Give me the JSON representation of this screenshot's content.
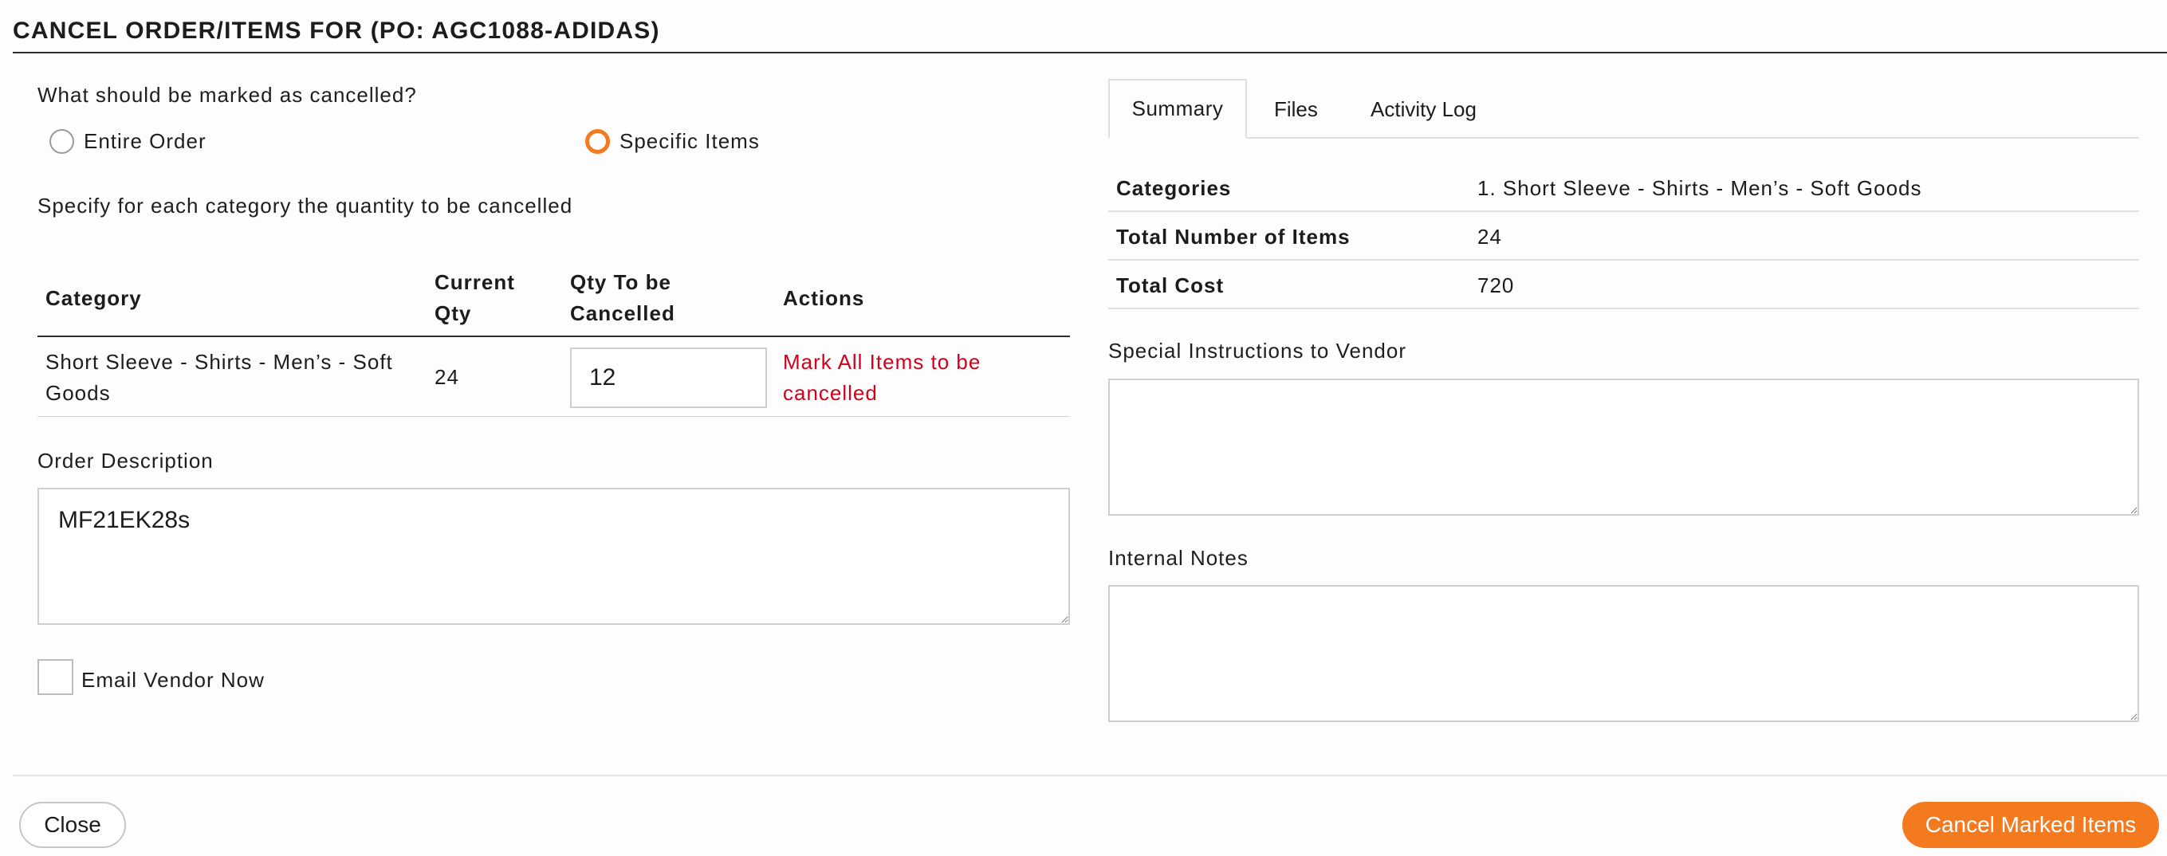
{
  "dialog": {
    "title": "CANCEL ORDER/ITEMS FOR (PO: AGC1088-ADIDAS)"
  },
  "left": {
    "question": "What should be marked as cancelled?",
    "options": [
      {
        "label": "Entire Order",
        "selected": false
      },
      {
        "label": "Specific Items",
        "selected": true
      }
    ],
    "instruction": "Specify for each category the quantity to be cancelled",
    "table": {
      "headers": {
        "category": "Category",
        "current_qty_line1": "Current",
        "current_qty_line2": "Qty",
        "qty_cancel_line1": "Qty To be",
        "qty_cancel_line2": "Cancelled",
        "actions": "Actions"
      },
      "rows": [
        {
          "category_line1": "Short Sleeve - Shirts - Men’s - Soft",
          "category_line2": "Goods",
          "current_qty": "24",
          "qty_to_cancel": "12",
          "action_line1": "Mark All Items to be",
          "action_line2": "cancelled"
        }
      ]
    },
    "order_description_label": "Order Description",
    "order_description_value": "MF21EK28s",
    "email_vendor_label": "Email Vendor Now",
    "email_vendor_checked": false
  },
  "right": {
    "tabs": [
      "Summary",
      "Files",
      "Activity Log"
    ],
    "active_tab": "Summary",
    "summary": [
      {
        "label": "Categories",
        "value": "1. Short Sleeve - Shirts - Men’s - Soft Goods"
      },
      {
        "label": "Total Number of Items",
        "value": "24"
      },
      {
        "label": "Total Cost",
        "value": "720"
      }
    ],
    "special_instructions_label": "Special Instructions to Vendor",
    "internal_notes_label": "Internal Notes"
  },
  "footer": {
    "close_label": "Close",
    "cancel_label": "Cancel Marked Items"
  },
  "colors": {
    "accent": "#f47a20",
    "danger": "#d0021b"
  }
}
